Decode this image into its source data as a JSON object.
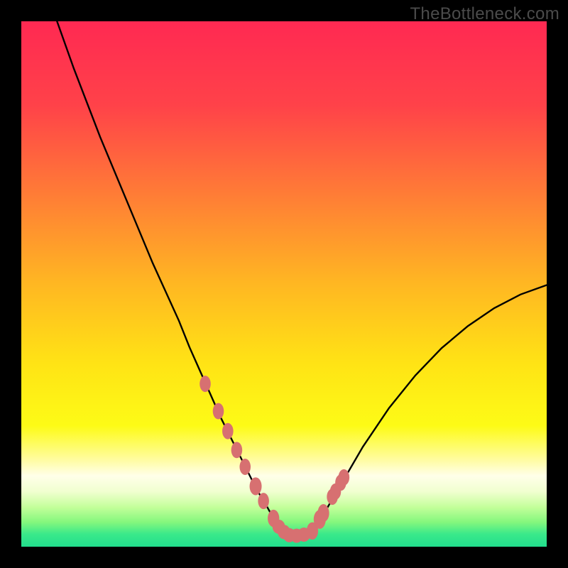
{
  "watermark": "TheBottleneck.com",
  "chart_data": {
    "type": "line",
    "title": "",
    "xlabel": "",
    "ylabel": "",
    "xlim": [
      0,
      100
    ],
    "ylim": [
      0,
      100
    ],
    "grid": false,
    "legend": false,
    "series": [
      {
        "name": "bottleneck-curve",
        "x": [
          6.8,
          10,
          15,
          20,
          25,
          30,
          32,
          34,
          36,
          38,
          40,
          42,
          44,
          45,
          46,
          47,
          48,
          49,
          50,
          51,
          52,
          53,
          54,
          55,
          56,
          58,
          60,
          65,
          70,
          75,
          80,
          85,
          90,
          95,
          100
        ],
        "y": [
          100,
          91,
          78,
          66,
          54,
          43,
          38,
          33.5,
          29,
          24.5,
          20.5,
          16.5,
          12.5,
          10.5,
          9,
          7.2,
          5.4,
          3.8,
          2.8,
          2.2,
          2.0,
          2.0,
          2.2,
          2.8,
          3.8,
          7.0,
          10.4,
          19.0,
          26.4,
          32.6,
          37.8,
          42.0,
          45.4,
          48.0,
          49.8
        ]
      }
    ],
    "markers": {
      "name": "data-points",
      "color": "#d77071",
      "x": [
        35.0,
        37.5,
        39.3,
        41.0,
        42.6,
        44.6,
        46.1,
        48.0,
        49.0,
        50.0,
        51.0,
        52.4,
        53.8,
        55.4,
        56.8,
        57.5,
        59.2,
        59.8,
        60.8,
        61.4
      ],
      "y": [
        31.0,
        25.8,
        22.0,
        18.4,
        15.2,
        11.5,
        8.7,
        5.4,
        3.8,
        2.8,
        2.2,
        2.1,
        2.3,
        3.0,
        5.2,
        6.4,
        9.5,
        10.5,
        12.2,
        13.2
      ],
      "rx": [
        1.05,
        1.05,
        1.05,
        1.05,
        1.05,
        1.15,
        1.05,
        1.1,
        1.2,
        1.2,
        1.2,
        1.2,
        1.2,
        1.1,
        1.15,
        1.1,
        1.05,
        1.05,
        1.05,
        1.05
      ],
      "ry": [
        1.55,
        1.55,
        1.55,
        1.55,
        1.55,
        1.7,
        1.55,
        1.65,
        1.35,
        1.35,
        1.35,
        1.35,
        1.35,
        1.65,
        1.8,
        1.7,
        1.55,
        1.55,
        1.55,
        1.55
      ]
    },
    "background_gradient": {
      "stops": [
        {
          "offset": 0.0,
          "color": "#ff2952"
        },
        {
          "offset": 0.16,
          "color": "#ff4249"
        },
        {
          "offset": 0.32,
          "color": "#ff7937"
        },
        {
          "offset": 0.5,
          "color": "#ffb722"
        },
        {
          "offset": 0.65,
          "color": "#ffe315"
        },
        {
          "offset": 0.77,
          "color": "#fdfb16"
        },
        {
          "offset": 0.835,
          "color": "#fffca2"
        },
        {
          "offset": 0.865,
          "color": "#ffffe9"
        },
        {
          "offset": 0.895,
          "color": "#f1ffd0"
        },
        {
          "offset": 0.925,
          "color": "#c3ff9a"
        },
        {
          "offset": 0.953,
          "color": "#85f77d"
        },
        {
          "offset": 0.976,
          "color": "#3ae98a"
        },
        {
          "offset": 1.0,
          "color": "#22de8d"
        }
      ]
    }
  }
}
